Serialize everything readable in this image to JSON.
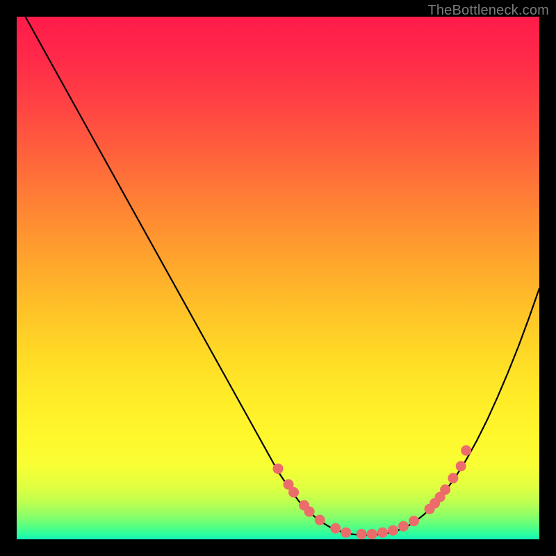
{
  "attribution": "TheBottleneck.com",
  "chart_data": {
    "type": "line",
    "title": "",
    "xlabel": "",
    "ylabel": "",
    "xlim": [
      0,
      100
    ],
    "ylim": [
      0,
      100
    ],
    "x": [
      0,
      2,
      4,
      6,
      8,
      10,
      12,
      14,
      16,
      18,
      20,
      22,
      24,
      26,
      28,
      30,
      32,
      34,
      36,
      38,
      40,
      42,
      44,
      46,
      48,
      50,
      52,
      54,
      56,
      58,
      60,
      62,
      64,
      66,
      68,
      70,
      72,
      74,
      76,
      78,
      80,
      82,
      84,
      86,
      88,
      90,
      92,
      94,
      96,
      98,
      100
    ],
    "values": [
      103,
      99.4,
      95.8,
      92.2,
      88.6,
      85.0,
      81.4,
      77.8,
      74.2,
      70.6,
      67.0,
      63.4,
      59.8,
      56.2,
      52.6,
      49.0,
      45.4,
      41.8,
      38.2,
      34.6,
      31.0,
      27.4,
      23.8,
      20.2,
      16.6,
      13.0,
      10.0,
      7.3,
      5.2,
      3.5,
      2.3,
      1.5,
      1.0,
      0.8,
      0.8,
      1.0,
      1.4,
      2.1,
      3.2,
      4.8,
      6.8,
      9.2,
      12.0,
      15.2,
      18.8,
      22.8,
      27.2,
      31.9,
      36.9,
      42.3,
      48.0
    ],
    "scatter_points": [
      {
        "x": 50,
        "y": 13.5
      },
      {
        "x": 52,
        "y": 10.5
      },
      {
        "x": 53,
        "y": 9.0
      },
      {
        "x": 55,
        "y": 6.5
      },
      {
        "x": 56,
        "y": 5.3
      },
      {
        "x": 58,
        "y": 3.7
      },
      {
        "x": 61,
        "y": 2.1
      },
      {
        "x": 63,
        "y": 1.3
      },
      {
        "x": 66,
        "y": 1.0
      },
      {
        "x": 68,
        "y": 1.0
      },
      {
        "x": 70,
        "y": 1.3
      },
      {
        "x": 72,
        "y": 1.7
      },
      {
        "x": 74,
        "y": 2.5
      },
      {
        "x": 76,
        "y": 3.5
      },
      {
        "x": 79,
        "y": 5.8
      },
      {
        "x": 80,
        "y": 6.9
      },
      {
        "x": 81,
        "y": 8.1
      },
      {
        "x": 82,
        "y": 9.5
      },
      {
        "x": 83.5,
        "y": 11.7
      },
      {
        "x": 85,
        "y": 14.0
      },
      {
        "x": 86,
        "y": 17.0
      }
    ],
    "gradient_stops": [
      {
        "offset": 0.0,
        "color": "#ff1b4b"
      },
      {
        "offset": 0.08,
        "color": "#ff2a49"
      },
      {
        "offset": 0.16,
        "color": "#ff4044"
      },
      {
        "offset": 0.24,
        "color": "#ff5a3e"
      },
      {
        "offset": 0.32,
        "color": "#ff7537"
      },
      {
        "offset": 0.4,
        "color": "#ff8f31"
      },
      {
        "offset": 0.48,
        "color": "#ffa92c"
      },
      {
        "offset": 0.56,
        "color": "#ffc228"
      },
      {
        "offset": 0.64,
        "color": "#ffd826"
      },
      {
        "offset": 0.72,
        "color": "#ffea27"
      },
      {
        "offset": 0.8,
        "color": "#fff72c"
      },
      {
        "offset": 0.86,
        "color": "#f7ff34"
      },
      {
        "offset": 0.9,
        "color": "#e0ff40"
      },
      {
        "offset": 0.93,
        "color": "#bcff51"
      },
      {
        "offset": 0.955,
        "color": "#8cff67"
      },
      {
        "offset": 0.975,
        "color": "#57ff82"
      },
      {
        "offset": 0.99,
        "color": "#2cffa0"
      },
      {
        "offset": 1.0,
        "color": "#14f0b9"
      }
    ],
    "scatter_color": "#ec6b6b",
    "line_color": "#000000"
  }
}
